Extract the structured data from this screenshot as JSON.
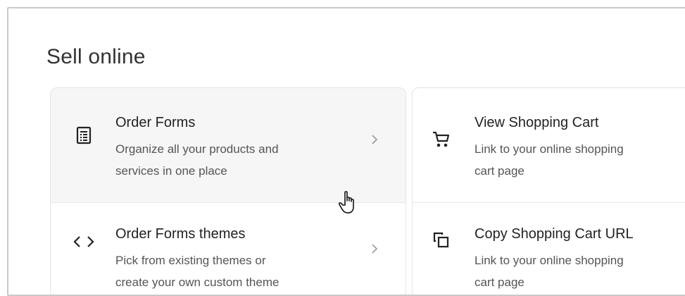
{
  "section": {
    "title": "Sell online"
  },
  "items": [
    {
      "title": "Order Forms",
      "description_line1": "Organize all your products and",
      "description_line2": "services in one place",
      "icon": "form-list-icon"
    },
    {
      "title": "Order Forms themes",
      "description_line1": "Pick from existing themes or",
      "description_line2": "create your own custom theme",
      "icon": "code-brackets-icon"
    },
    {
      "title": "View Shopping Cart",
      "description_line1": "Link to your online shopping",
      "description_line2": "cart page",
      "icon": "shopping-cart-icon"
    },
    {
      "title": "Copy Shopping Cart URL",
      "description_line1": "Link to your online shopping",
      "description_line2": "cart page",
      "icon": "copy-icon"
    }
  ],
  "colors": {
    "text": "#222222",
    "muted": "#555555",
    "hover_bg": "#f6f6f6",
    "border": "#e4e4e4"
  }
}
